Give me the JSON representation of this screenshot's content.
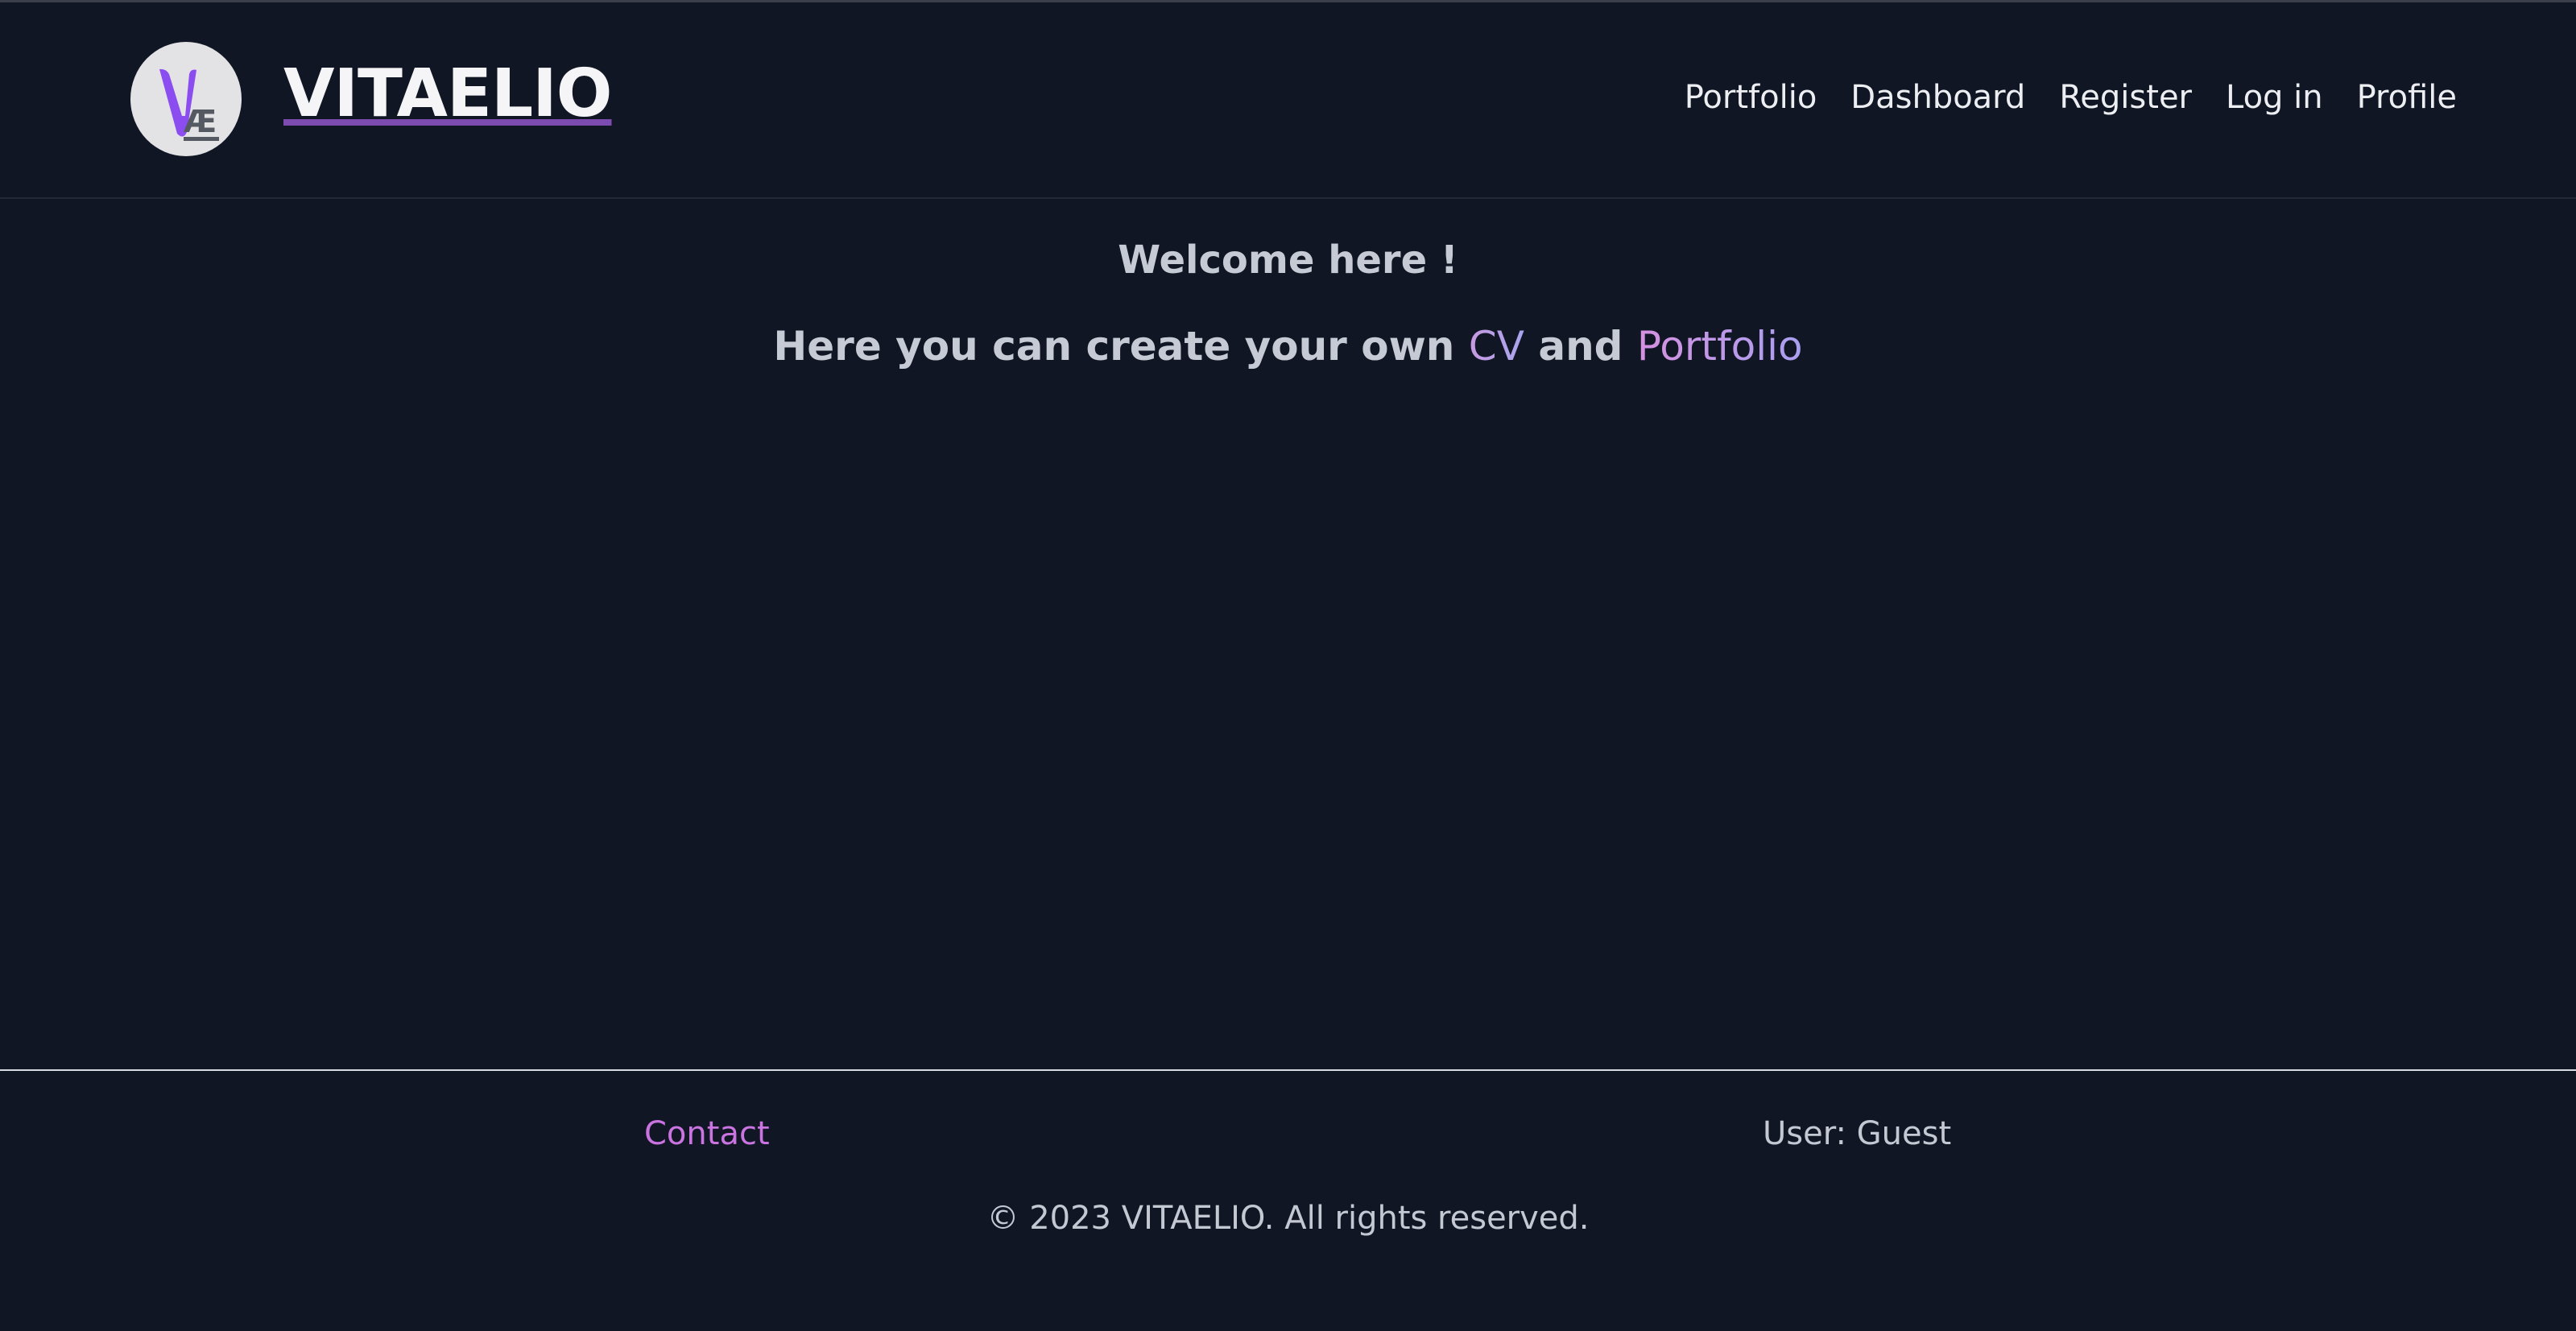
{
  "header": {
    "brand": "VITAELIO",
    "logo": {
      "icon": "vitaelio-logo-icon",
      "letters": "VÆ",
      "accent_color": "#8b4cf0"
    },
    "nav": [
      {
        "label": "Portfolio"
      },
      {
        "label": "Dashboard"
      },
      {
        "label": "Register"
      },
      {
        "label": "Log in"
      },
      {
        "label": "Profile"
      }
    ]
  },
  "main": {
    "welcome": "Welcome here !",
    "tagline": {
      "prefix": "Here you can create your own ",
      "cv": "CV",
      "conjunction": " and ",
      "portfolio": "Portfolio"
    }
  },
  "footer": {
    "contact": "Contact",
    "user_status": "User: Guest",
    "copyright": "© 2023 VITAELIO. All rights reserved."
  },
  "colors": {
    "background": "#101624",
    "link_accent": "#c974e0",
    "text": "#c6cad4"
  }
}
